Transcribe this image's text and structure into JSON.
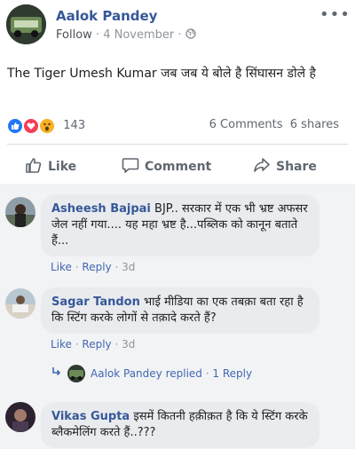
{
  "post": {
    "author": "Aalok Pandey",
    "follow_label": "Follow",
    "separator": " · ",
    "date": "4 November",
    "separator2": " · ",
    "text": "The Tiger Umesh Kumar जब जब ये बोले है सिंघासन डोले है",
    "reaction_count": "143",
    "comments_count": "6 Comments",
    "shares_count": "6 shares",
    "more_icon": "•••"
  },
  "actions": {
    "like": "Like",
    "comment": "Comment",
    "share": "Share"
  },
  "comments": [
    {
      "name": "Asheesh Bajpai",
      "text": " BJP.. सरकार में एक भी भ्रष्ट अफसर जेल नहीं गया.... यह महा भ्रष्ट है...पब्लिक को कानून बताते हैं...",
      "like": "Like",
      "reply": "Reply",
      "dot1": " · ",
      "dot2": " · ",
      "time": "3d"
    },
    {
      "name": "Sagar Tandon",
      "text": " भाई मीडिया का एक तबक़ा बता रहा है कि स्टिंग करके लोगों से तक़ादे करते हैं?",
      "like": "Like",
      "reply": "Reply",
      "dot1": " · ",
      "dot2": " · ",
      "time": "3d",
      "replied_by": "Aalok Pandey replied",
      "reply_sep": " · ",
      "reply_count": "1 Reply"
    },
    {
      "name": "Vikas Gupta",
      "text": " इसमें कितनी हक़ीक़त है कि ये स्टिंग करके ब्लैकमेलिंग करते हैं..???"
    }
  ],
  "colors": {
    "link": "#365899",
    "like_blue": "#2078f4",
    "love_red": "#f33e58",
    "wow_yellow": "#f7b125"
  }
}
